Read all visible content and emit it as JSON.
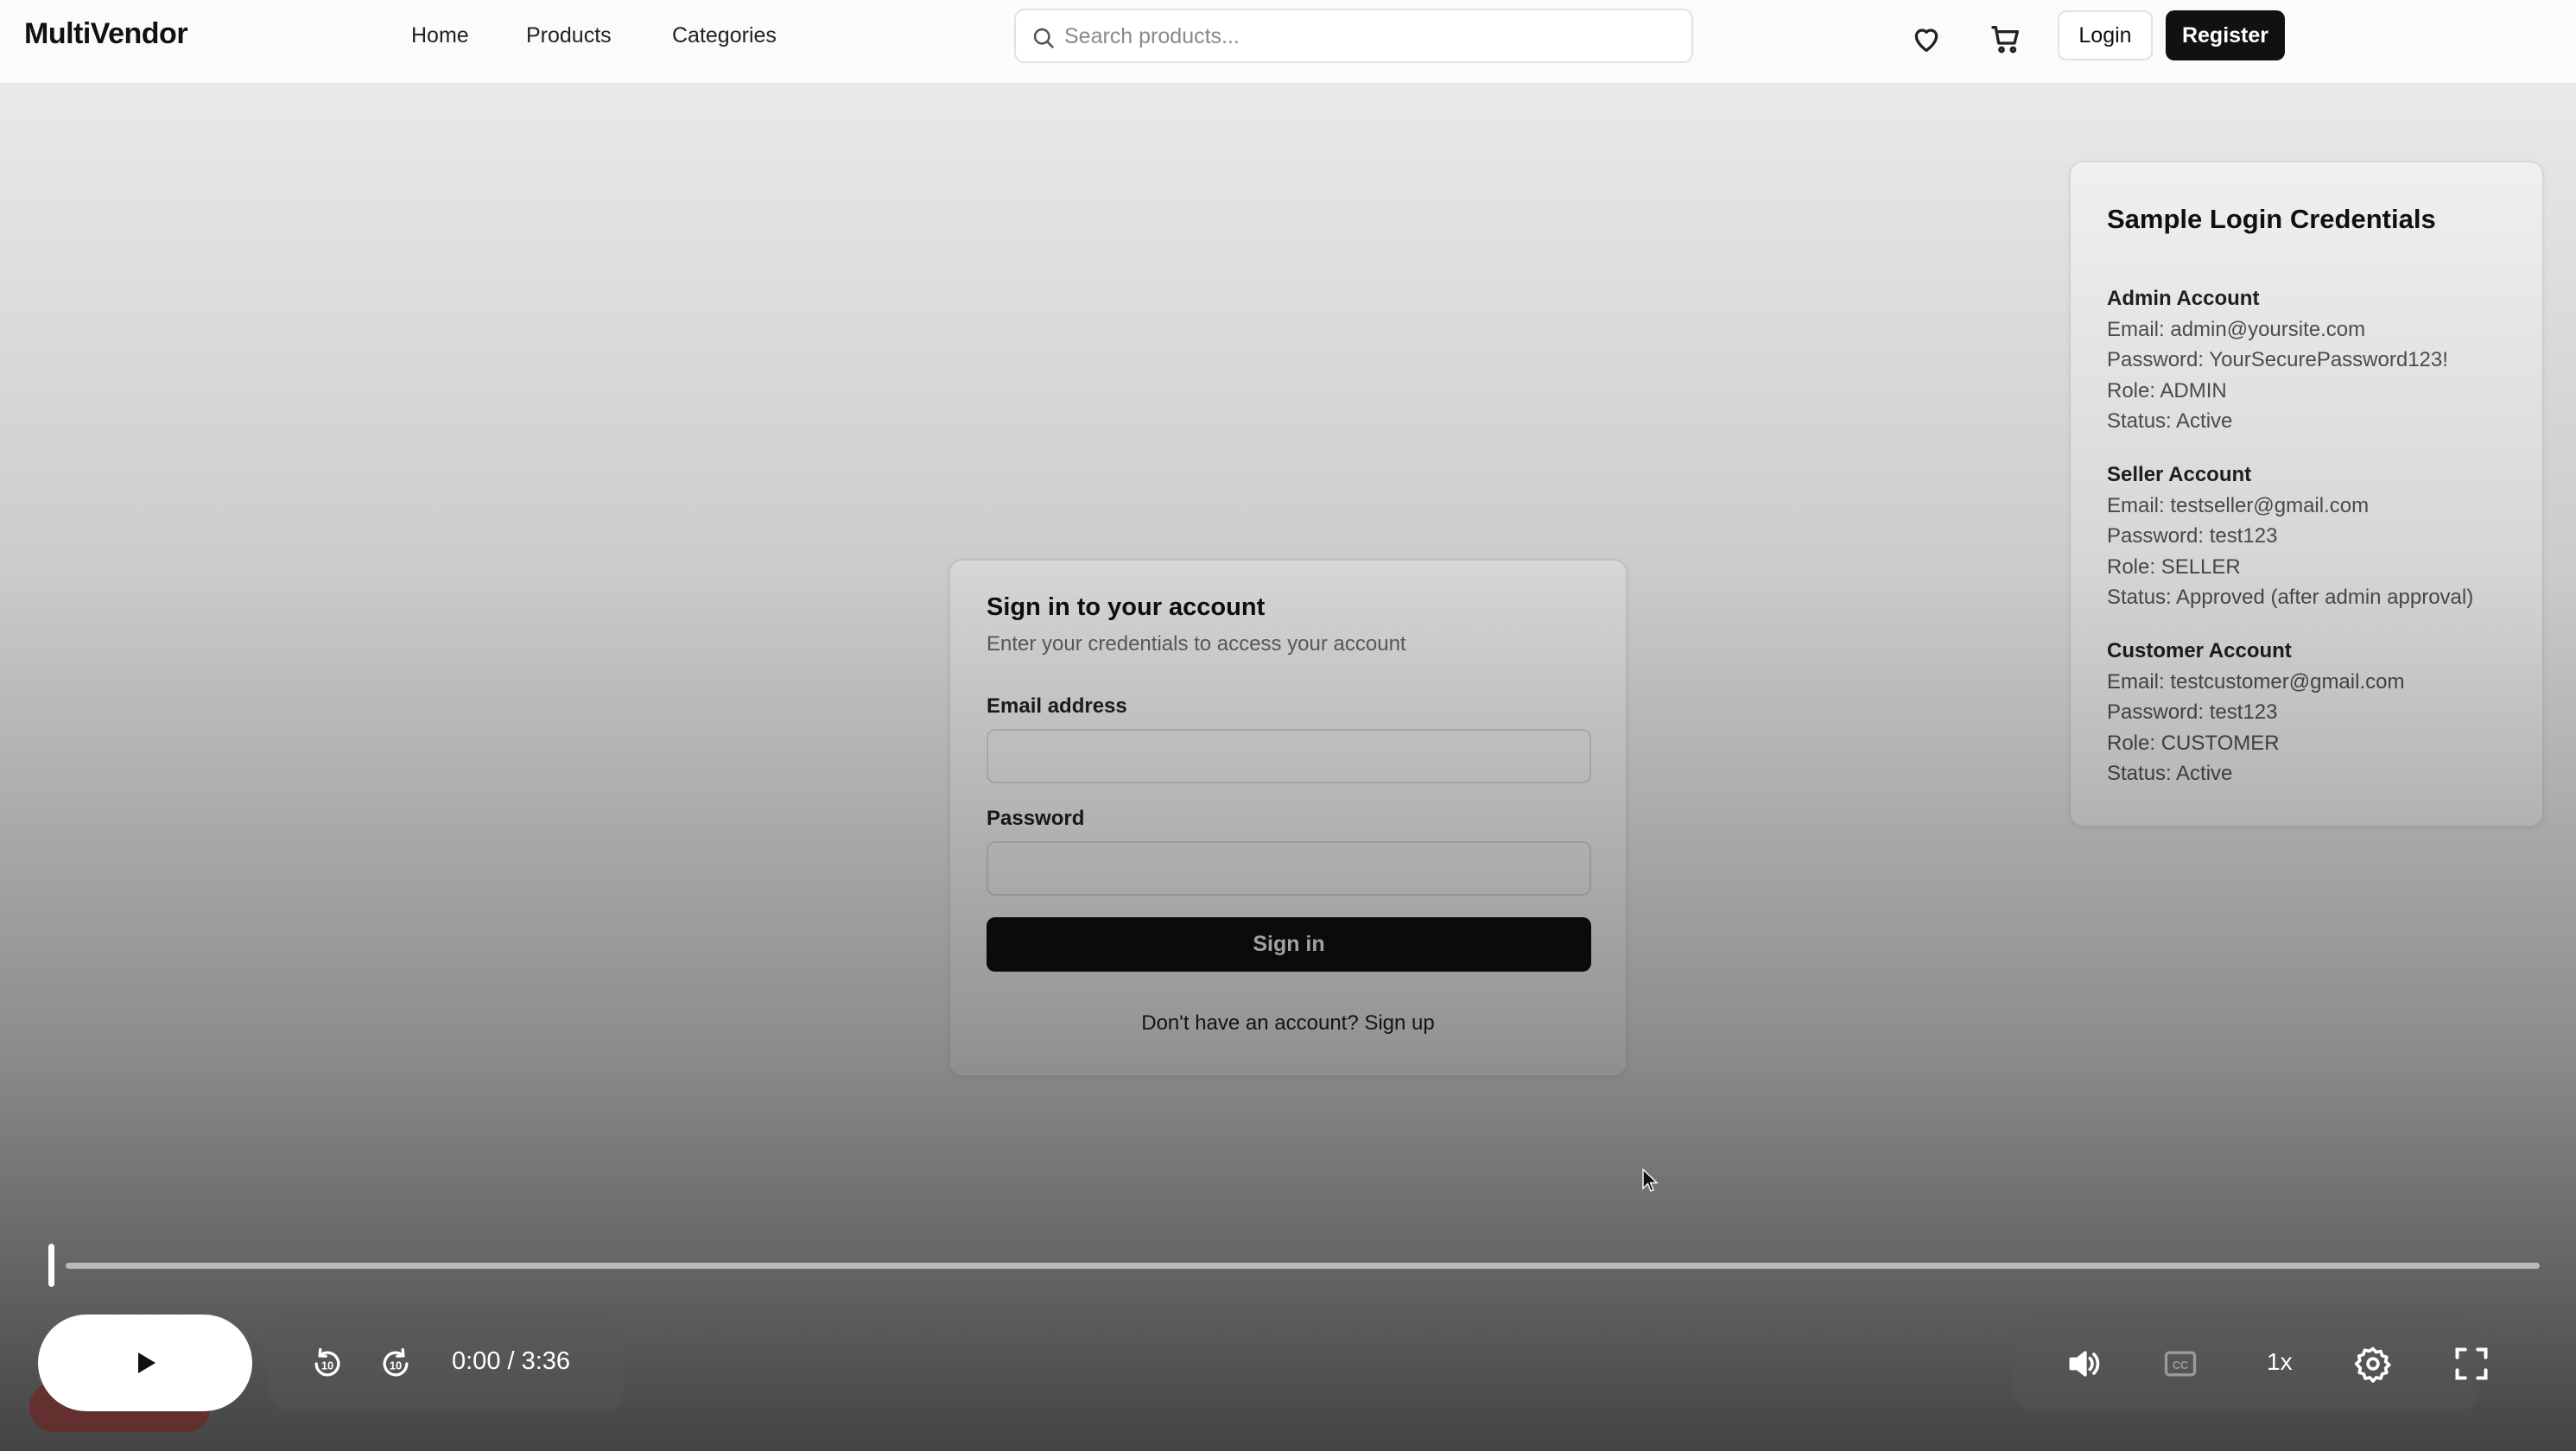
{
  "brand": "MultiVendor",
  "nav": {
    "home": "Home",
    "products": "Products",
    "categories": "Categories"
  },
  "search": {
    "placeholder": "Search products...",
    "icon": "search-icon"
  },
  "header_actions": {
    "wishlist_icon": "heart-icon",
    "cart_icon": "cart-icon",
    "login": "Login",
    "register": "Register"
  },
  "signin": {
    "title": "Sign in to your account",
    "subtitle": "Enter your credentials to access your account",
    "email_label": "Email address",
    "email_value": "",
    "password_label": "Password",
    "password_value": "",
    "button": "Sign in",
    "signup_text": "Don't have an account? Sign up"
  },
  "credentials": {
    "title": "Sample Login Credentials",
    "accounts": [
      {
        "heading": "Admin Account",
        "email": "Email: admin@yoursite.com",
        "password": "Password: YourSecurePassword123!",
        "role": "Role: ADMIN",
        "status": "Status: Active"
      },
      {
        "heading": "Seller Account",
        "email": "Email: testseller@gmail.com",
        "password": "Password: test123",
        "role": "Role: SELLER",
        "status": "Status: Approved (after admin approval)"
      },
      {
        "heading": "Customer Account",
        "email": "Email: testcustomer@gmail.com",
        "password": "Password: test123",
        "role": "Role: CUSTOMER",
        "status": "Status: Active"
      }
    ]
  },
  "player": {
    "time": "0:00 / 3:36",
    "progress": 0.0,
    "speed": "1x",
    "icons": [
      "play-icon",
      "rewind-10-icon",
      "forward-10-icon",
      "volume-icon",
      "captions-icon",
      "settings-icon",
      "fullscreen-icon"
    ]
  },
  "colors": {
    "primary": "#111111",
    "border": "#e2e2e2",
    "muted_text": "#6e6e6e"
  }
}
